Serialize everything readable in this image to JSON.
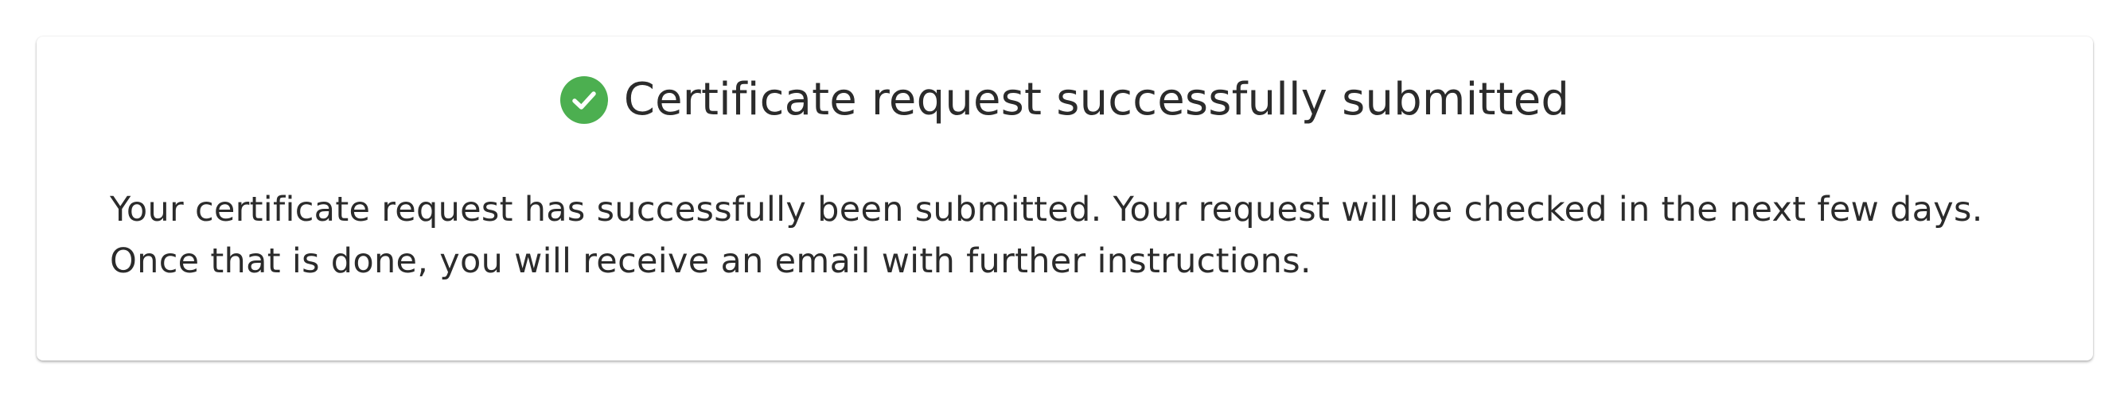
{
  "dialog": {
    "title": "Certificate request successfully submitted",
    "icon": "check-circle-icon",
    "icon_color": "#4caf50",
    "message_lines": [
      "Your certificate request has successfully been submitted. Your request will be checked in the next few days.",
      "Once that is done, you will receive an email with further instructions."
    ]
  }
}
